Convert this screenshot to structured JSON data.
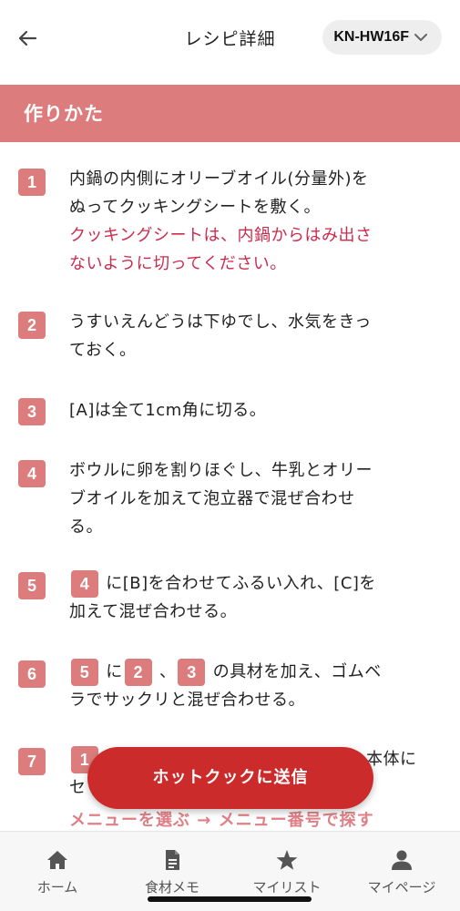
{
  "header": {
    "title": "レシピ詳細",
    "model": "KN-HW16F"
  },
  "section": {
    "title": "作りかた"
  },
  "steps": [
    {
      "num": "1",
      "line1": "内鍋の内側にオリーブオイル(分量外)を",
      "line2": "ぬってクッキングシートを敷く。",
      "warn1": "クッキングシートは、内鍋からはみ出さ",
      "warn2": "ないように切ってください。"
    },
    {
      "num": "2",
      "line1": "うすいえんどうは下ゆでし、水気をきっ",
      "line2": "ておく。"
    },
    {
      "num": "3",
      "line1": "[A]は全て1cm角に切る。"
    },
    {
      "num": "4",
      "line1": "ボウルに卵を割りほぐし、牛乳とオリー",
      "line2": "ブオイルを加えて泡立器で混ぜ合わせ",
      "line3": "る。"
    },
    {
      "num": "5",
      "ref": "4",
      "line1": "に[B]を合わせてふるい入れ、[C]を",
      "line2": "加えて混ぜ合わせる。"
    },
    {
      "num": "6",
      "ref1": "5",
      "mid1": "に",
      "ref2": "2",
      "mid2": "、",
      "ref3": "3",
      "line1": "の具材を加え、ゴムベ",
      "line2": "ラでサックリと混ぜ合わせる。"
    },
    {
      "num": "7",
      "ref": "1",
      "line1": "本体に",
      "line2": "セ"
    }
  ],
  "menu_link": "メニューを選ぶ → メニュー番号で探す",
  "send_button": "ホットクックに送信",
  "tabs": [
    {
      "label": "ホーム",
      "icon": "home-icon"
    },
    {
      "label": "食材メモ",
      "icon": "document-icon"
    },
    {
      "label": "マイリスト",
      "icon": "star-icon"
    },
    {
      "label": "マイページ",
      "icon": "person-icon"
    }
  ],
  "colors": {
    "accent": "#dc7c7c",
    "warning": "#cc2b4d",
    "button": "#cc2b2b"
  }
}
